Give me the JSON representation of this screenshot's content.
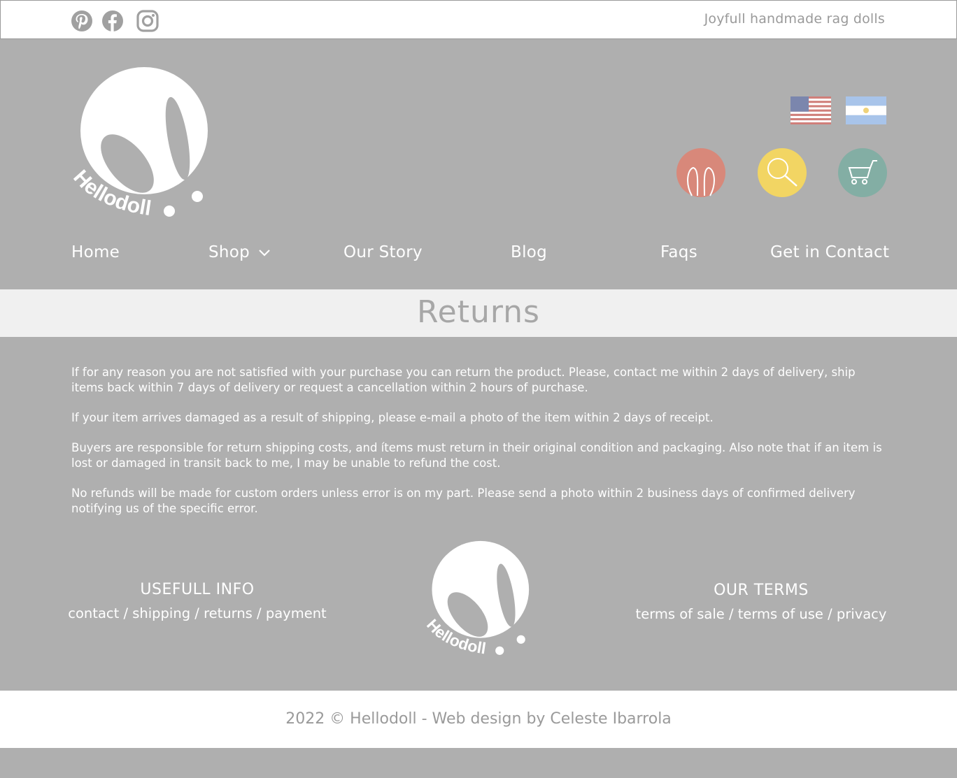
{
  "topbar": {
    "social_icons": [
      "pinterest-icon",
      "facebook-icon",
      "instagram-icon"
    ],
    "tagline": "Joyfull handmade rag dolls"
  },
  "header": {
    "logo_text": "Hellodoll",
    "flags": [
      "us-flag-icon",
      "argentina-flag-icon"
    ],
    "buttons": [
      {
        "icon": "bunny-ears-icon",
        "color": "#d8887a"
      },
      {
        "icon": "search-icon",
        "color": "#f2d563"
      },
      {
        "icon": "cart-icon",
        "color": "#83aea4"
      }
    ]
  },
  "nav": {
    "home": "Home",
    "shop": "Shop",
    "our_story": "Our Story",
    "blog": "Blog",
    "faqs": "Faqs",
    "contact": "Get in Contact"
  },
  "page": {
    "title": "Returns",
    "paragraphs": [
      "If for any reason you are not satisfied with your purchase you can return the product. Please, contact me within 2 days of delivery, ship items back within 7 days of delivery or request a cancellation within 2 hours of purchase.",
      "If your item arrives damaged as a result of shipping, please e-mail a photo of the item within 2 days of receipt.",
      "Buyers are responsible for return shipping costs, and ítems must return in their original condition and packaging. Also note that if an item is lost or damaged in transit back to me, I may be unable to refund the cost.",
      "No refunds will be made for custom orders unless error is on my part. Please send a photo within 2 business days of confirmed delivery notifying us of the specific error."
    ]
  },
  "footer": {
    "usefull_heading": "USEFULL INFO",
    "usefull_links": [
      "contact",
      "shipping",
      "returns",
      "payment"
    ],
    "terms_heading": "OUR TERMS",
    "terms_links": [
      "terms of sale",
      "terms of use",
      "privacy"
    ],
    "logo_text": "Hellodoll",
    "copyright": "2022 © Hellodoll - Web design by Celeste Ibarrola"
  },
  "colors": {
    "background": "#afafaf",
    "title_band": "#f0f0f0",
    "text_grey": "#9a9a9a"
  }
}
